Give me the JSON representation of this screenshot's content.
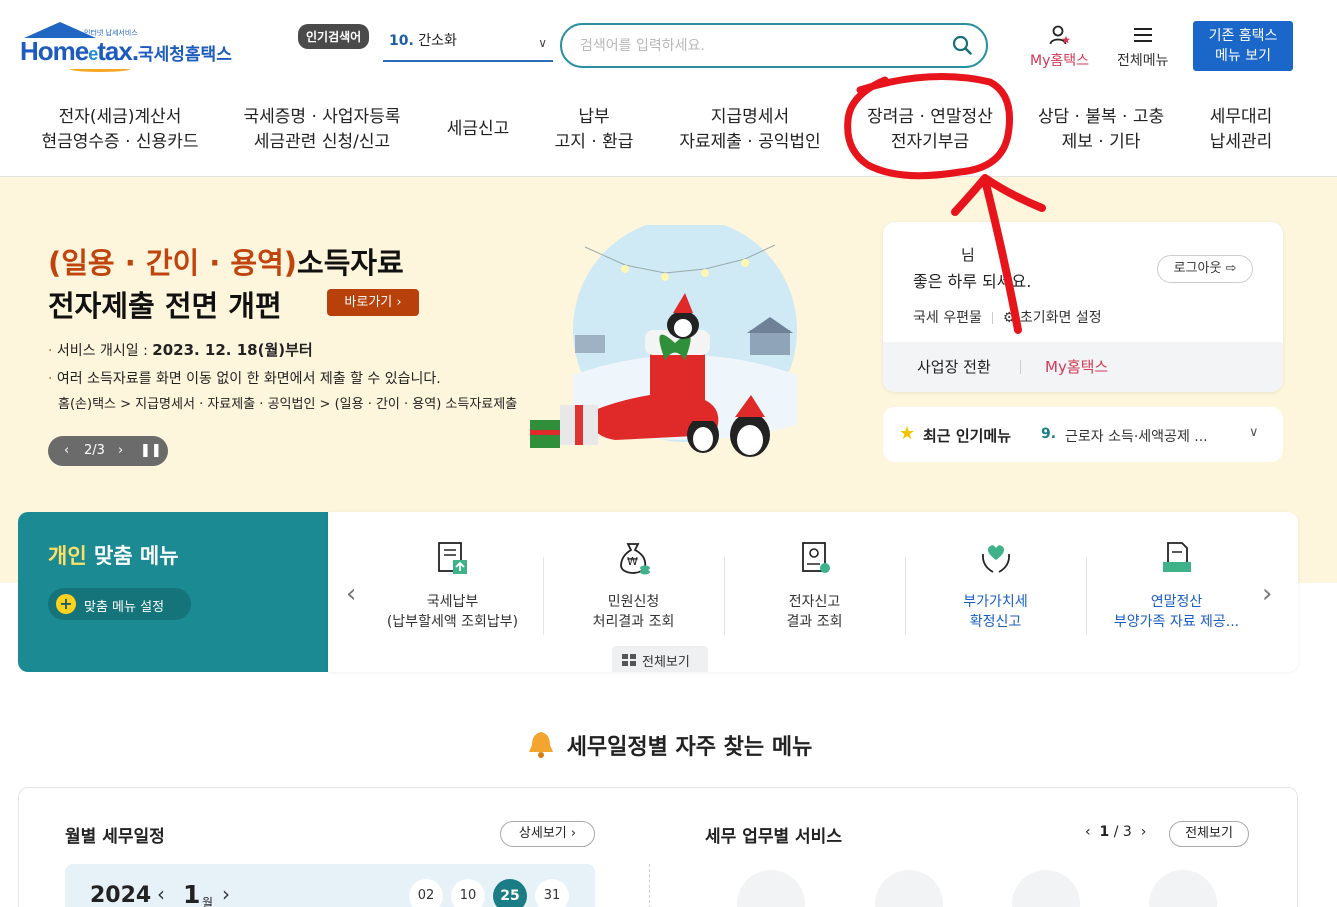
{
  "header": {
    "logo_tiny": "인터넷 납세서비스",
    "logo_word": "Home",
    "logo_word_e": "e",
    "logo_word_tail": "tax.",
    "logo_kor": "국세청홈택스",
    "popular_badge": "인기검색어",
    "popular_num": "10.",
    "popular_term": "간소화",
    "search_placeholder": "검색어를 입력하세요.",
    "my_hometax": "My홈택스",
    "all_menu": "전체메뉴",
    "old_menu_line1": "기존 홈택스",
    "old_menu_line2": "메뉴 보기"
  },
  "gnb": [
    {
      "l1": "전자(세금)계산서",
      "l2": "현금영수증 · 신용카드"
    },
    {
      "l1": "국세증명 · 사업자등록",
      "l2": "세금관련 신청/신고"
    },
    {
      "l1": "세금신고",
      "l2": ""
    },
    {
      "l1": "납부",
      "l2": "고지 · 환급"
    },
    {
      "l1": "지급명세서",
      "l2": "자료제출 · 공익법인"
    },
    {
      "l1": "장려금 · 연말정산",
      "l2": "전자기부금"
    },
    {
      "l1": "상담 · 불복 · 고충",
      "l2": "제보 · 기타"
    },
    {
      "l1": "세무대리",
      "l2": "납세관리"
    }
  ],
  "banner": {
    "title_accent": "(일용 · 간이 · 용역)",
    "title_rest": "소득자료",
    "title2": "전자제출 전면 개편",
    "go_button": "바로가기",
    "line1_label": "서비스 개시일 : ",
    "line1_value": "2023. 12. 18(월)부터",
    "line2": "여러 소득자료를 화면 이동 없이 한 화면에서 제출 할 수 있습니다.",
    "path": "홈(손)택스 > 지급명세서 · 자료제출 · 공익법인 > (일용 · 간이 · 용역) 소득자료제출",
    "pager": "2/3"
  },
  "login": {
    "name_suffix": "님",
    "greeting": "좋은 하루 되세요.",
    "logout": "로그아웃",
    "link1": "국세 우편물",
    "link2": "초기화면 설정",
    "switch": "사업장 전환",
    "my": "My홈택스"
  },
  "recent": {
    "label": "최근 인기메뉴",
    "num": "9.",
    "text": "근로자 소득·세액공제 ..."
  },
  "custom_menu": {
    "title_y": "개인",
    "title_rest": " 맞춤 메뉴",
    "setting": "맞춤 메뉴 설정",
    "view_all": "전체보기",
    "items": [
      {
        "l1": "국세납부",
        "l2": "(납부할세액 조회납부)"
      },
      {
        "l1": "민원신청",
        "l2": "처리결과 조회"
      },
      {
        "l1": "전자신고",
        "l2": "결과 조회"
      },
      {
        "l1": "부가가치세",
        "l2": "확정신고"
      },
      {
        "l1": "연말정산",
        "l2": "부양가족 자료 제공..."
      }
    ]
  },
  "schedule": {
    "title": "세무일정별 자주 찾는 메뉴",
    "monthly_title": "월별 세무일정",
    "detail": "상세보기",
    "year": "2024",
    "month": "1",
    "month_unit": "월",
    "days": [
      "02",
      "10",
      "25",
      "31"
    ],
    "active_day": "25",
    "task_title": "세무 업무별 서비스",
    "task_page": "1",
    "task_total": "/ 3",
    "task_all": "전체보기"
  },
  "colors": {
    "accent_teal": "#1b8a92",
    "brand_blue": "#1a67c9",
    "my_red": "#d23a55",
    "annotation_red": "#e8141c"
  }
}
